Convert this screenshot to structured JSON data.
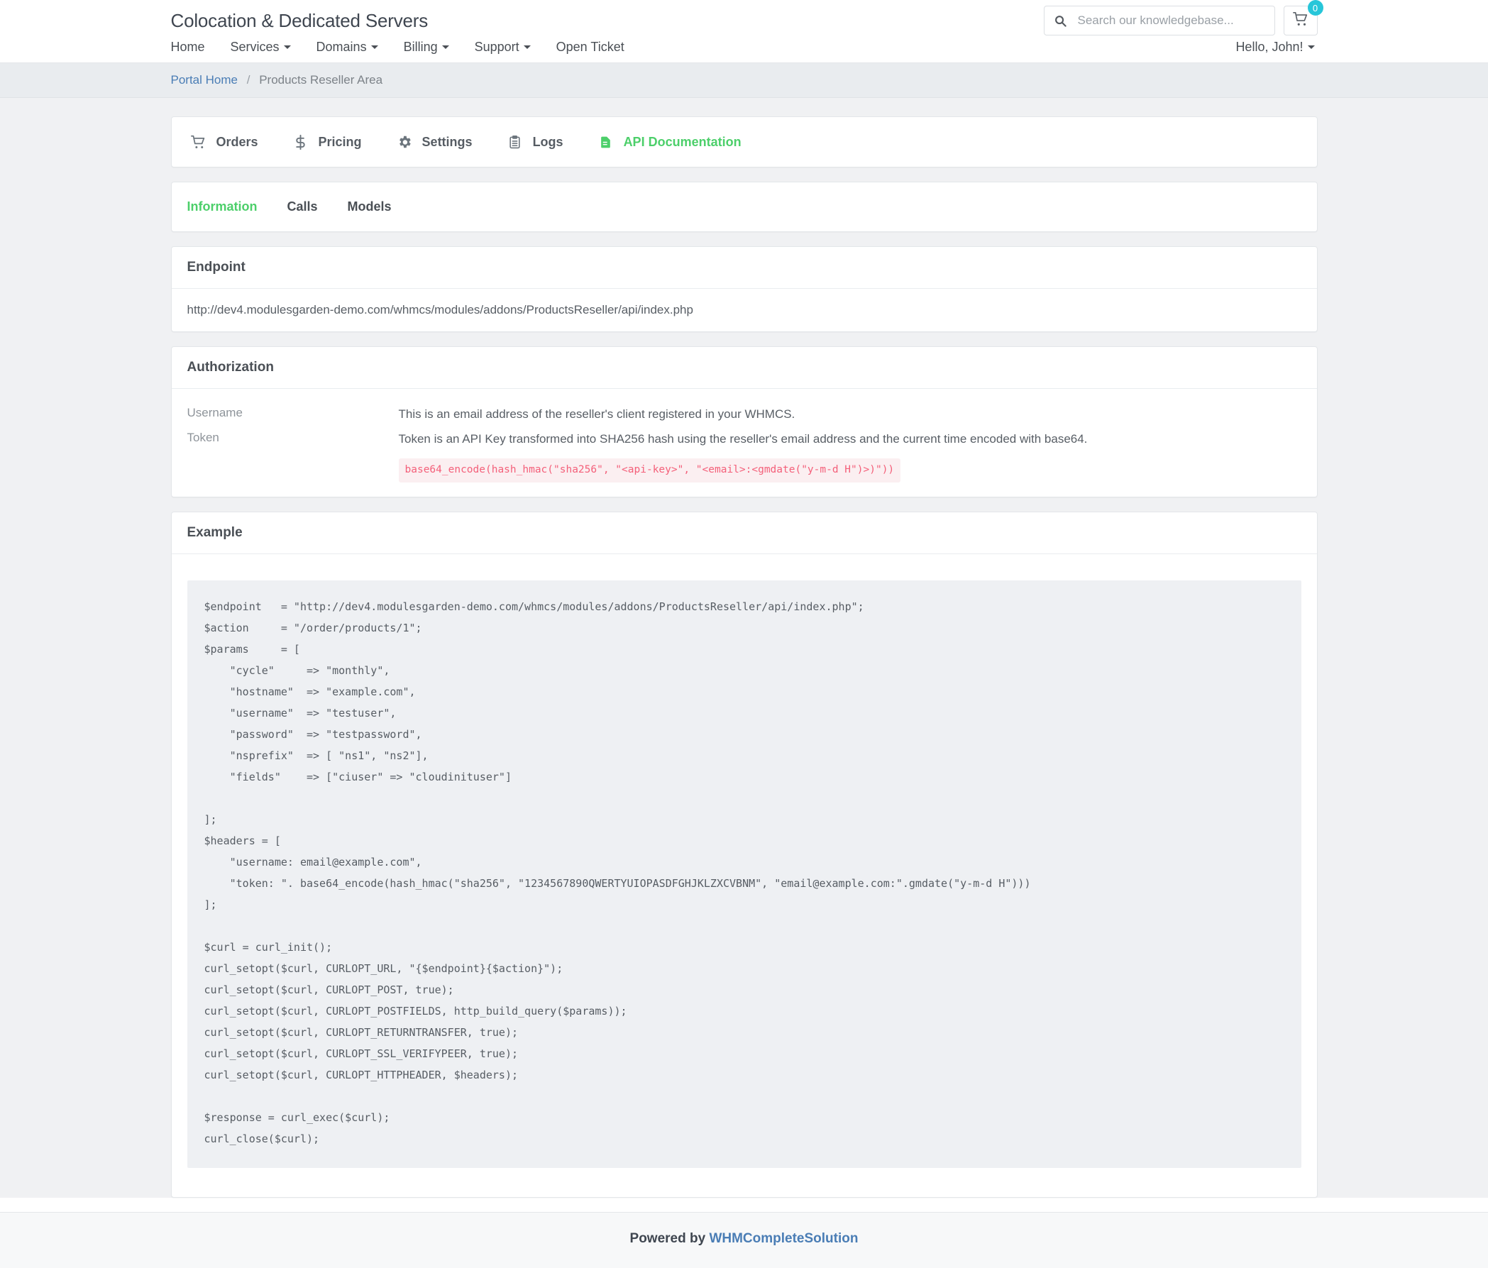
{
  "header": {
    "brand": "Colocation & Dedicated Servers",
    "search": {
      "placeholder": "Search our knowledgebase...",
      "value": "",
      "icon": "search-icon"
    },
    "cart": {
      "icon": "shopping-cart-icon",
      "badge_count": "0",
      "badge_color": "#27c6d9"
    },
    "nav": [
      {
        "label": "Home",
        "has_caret": false
      },
      {
        "label": "Services",
        "has_caret": true
      },
      {
        "label": "Domains",
        "has_caret": true
      },
      {
        "label": "Billing",
        "has_caret": true
      },
      {
        "label": "Support",
        "has_caret": true
      },
      {
        "label": "Open Ticket",
        "has_caret": false
      }
    ],
    "account": "Hello, John!"
  },
  "breadcrumb": {
    "home": "Portal Home",
    "separator": "/",
    "current": "Products Reseller Area"
  },
  "module_toolbar": {
    "items": [
      {
        "label": "Orders",
        "icon": "shopping-cart-icon",
        "active": false
      },
      {
        "label": "Pricing",
        "icon": "dollar-sign-icon",
        "active": false
      },
      {
        "label": "Settings",
        "icon": "gear-icon",
        "active": false
      },
      {
        "label": "Logs",
        "icon": "clipboard-icon",
        "active": false
      },
      {
        "label": "API Documentation",
        "icon": "file-document-icon",
        "active": true
      }
    ],
    "active_color": "#4ccf6a"
  },
  "tabs": {
    "items": [
      {
        "label": "Information",
        "active": true
      },
      {
        "label": "Calls",
        "active": false
      },
      {
        "label": "Models",
        "active": false
      }
    ]
  },
  "endpoint": {
    "title": "Endpoint",
    "url": "http://dev4.modulesgarden-demo.com/whmcs/modules/addons/ProductsReseller/api/index.php"
  },
  "authorization": {
    "title": "Authorization",
    "rows": [
      {
        "label": "Username",
        "value": "This is an email address of the reseller's client registered in your WHMCS.",
        "code": ""
      },
      {
        "label": "Token",
        "value": "Token is an API Key transformed into SHA256 hash using the reseller's email address and the current time encoded with base64.",
        "code": "base64_encode(hash_hmac(\"sha256\", \"<api-key>\", \"<email>:<gmdate(\"y-m-d H\")>)\"))"
      }
    ]
  },
  "example": {
    "title": "Example",
    "code": "$endpoint   = \"http://dev4.modulesgarden-demo.com/whmcs/modules/addons/ProductsReseller/api/index.php\";\n$action     = \"/order/products/1\";\n$params     = [\n    \"cycle\"     => \"monthly\",\n    \"hostname\"  => \"example.com\",\n    \"username\"  => \"testuser\",\n    \"password\"  => \"testpassword\",\n    \"nsprefix\"  => [ \"ns1\", \"ns2\"],\n    \"fields\"    => [\"ciuser\" => \"cloudinituser\"]\n\n];\n$headers = [\n    \"username: email@example.com\",\n    \"token: \". base64_encode(hash_hmac(\"sha256\", \"1234567890QWERTYUIOPASDFGHJKLZXCVBNM\", \"email@example.com:\".gmdate(\"y-m-d H\")))\n];\n\n$curl = curl_init();\ncurl_setopt($curl, CURLOPT_URL, \"{$endpoint}{$action}\");\ncurl_setopt($curl, CURLOPT_POST, true);\ncurl_setopt($curl, CURLOPT_POSTFIELDS, http_build_query($params));\ncurl_setopt($curl, CURLOPT_RETURNTRANSFER, true);\ncurl_setopt($curl, CURLOPT_SSL_VERIFYPEER, true);\ncurl_setopt($curl, CURLOPT_HTTPHEADER, $headers);\n\n$response = curl_exec($curl);\ncurl_close($curl);"
  },
  "footer": {
    "prefix": "Powered by ",
    "link": "WHMCompleteSolution"
  }
}
